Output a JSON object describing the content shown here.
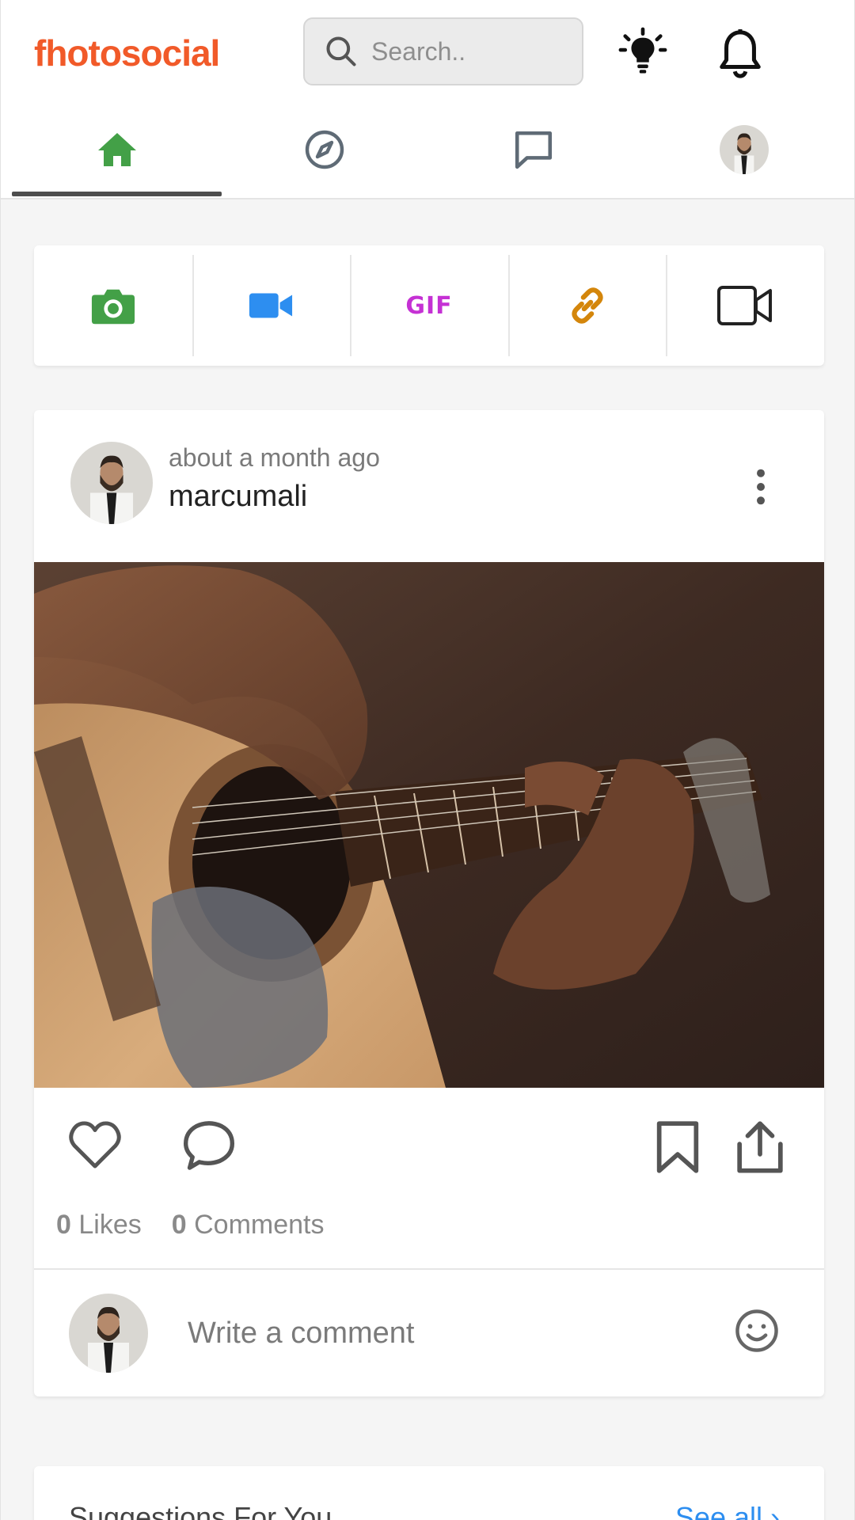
{
  "app": {
    "logo": "fhotosocial"
  },
  "header": {
    "search": {
      "placeholder": "Search.."
    },
    "icons": [
      "lightbulb-icon",
      "bell-icon"
    ]
  },
  "nav": {
    "items": [
      {
        "name": "home",
        "icon": "home-icon",
        "active": true
      },
      {
        "name": "explore",
        "icon": "compass-icon",
        "active": false
      },
      {
        "name": "messages",
        "icon": "chat-icon",
        "active": false
      },
      {
        "name": "profile",
        "icon": "avatar",
        "active": false
      }
    ]
  },
  "composer": {
    "buttons": [
      {
        "icon": "camera-icon",
        "color": "#43a047"
      },
      {
        "icon": "video-camera-icon",
        "color": "#2d8ef0"
      },
      {
        "icon": "gif-icon",
        "label": "GIF",
        "color": "#c531d4"
      },
      {
        "icon": "link-icon",
        "color": "#d4860b"
      },
      {
        "icon": "video-outline-icon",
        "color": "#222222"
      }
    ]
  },
  "post": {
    "time": "about a month ago",
    "username": "marcumali",
    "image_alt": "guitar photo",
    "likes_count": "0",
    "likes_label": "Likes",
    "comments_count": "0",
    "comments_label": "Comments",
    "comment_placeholder": "Write a comment"
  },
  "suggestions": {
    "title": "Suggestions For You",
    "see_all": "See all"
  },
  "colors": {
    "brand": "#f15a29",
    "home_active": "#43a047",
    "link": "#2d8ef0"
  }
}
